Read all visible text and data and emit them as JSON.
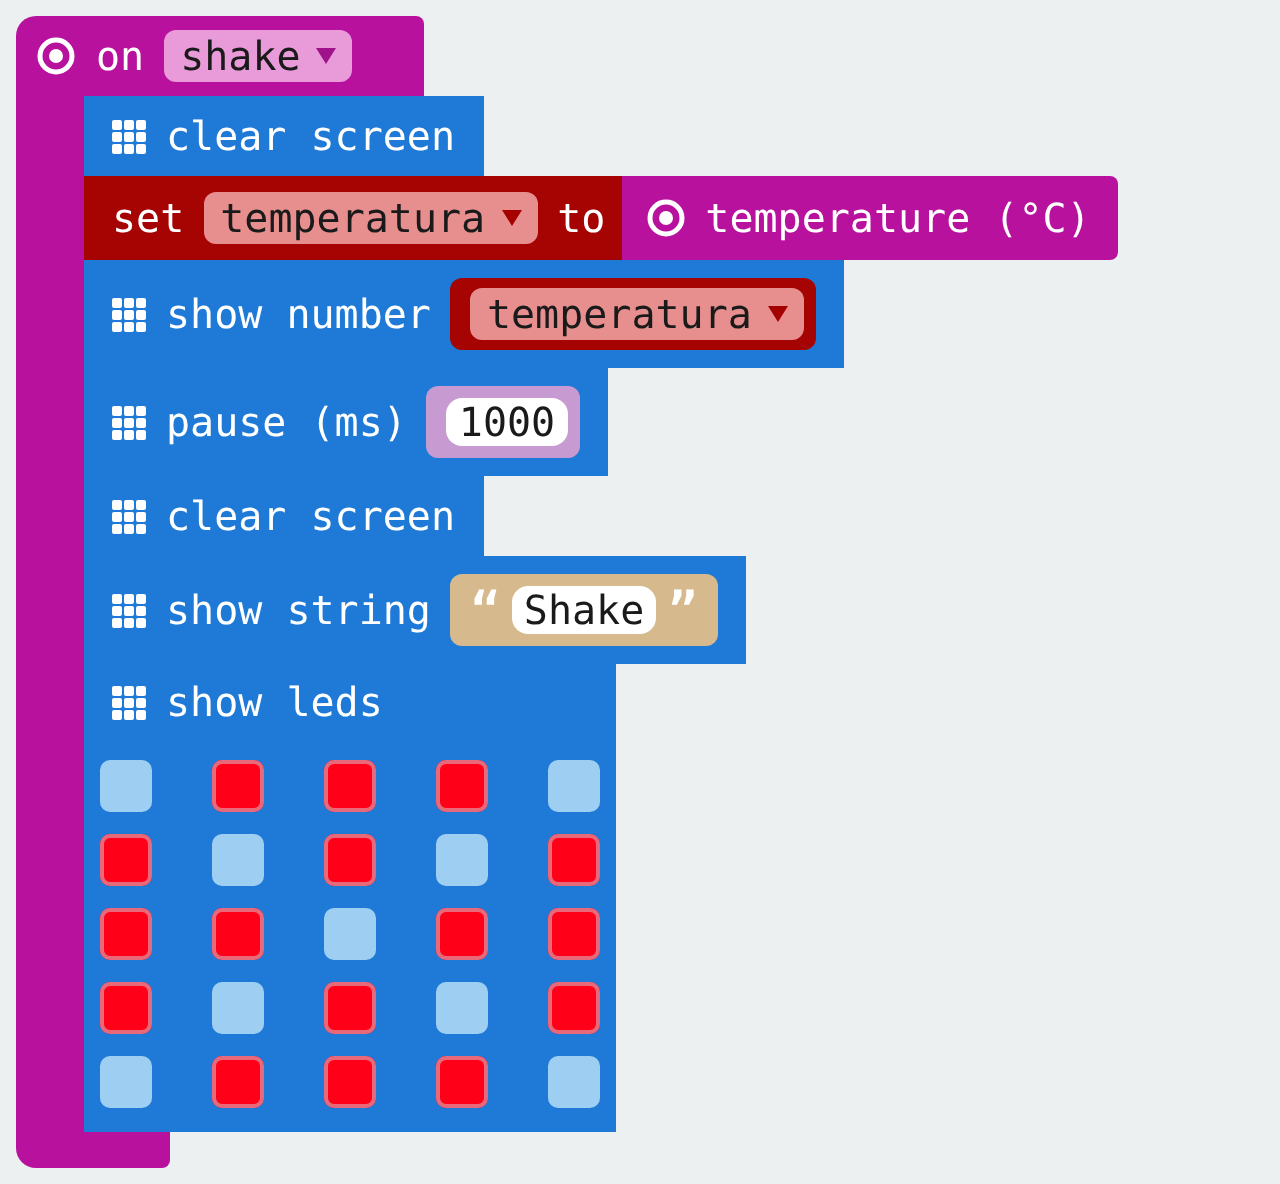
{
  "event": {
    "keyword": "on",
    "option": "shake"
  },
  "blocks": [
    {
      "kind": "plain",
      "label": "clear screen"
    },
    {
      "kind": "set",
      "label": "set",
      "variable": "temperatura",
      "connector": "to",
      "value": "temperature (°C)"
    },
    {
      "kind": "variable",
      "label": "show number",
      "variable": "temperatura"
    },
    {
      "kind": "number",
      "label": "pause (ms)",
      "value": "1000"
    },
    {
      "kind": "plain",
      "label": "clear screen"
    },
    {
      "kind": "string",
      "label": "show string",
      "open_quote": "“",
      "value": "Shake",
      "close_quote": "”"
    },
    {
      "kind": "leds",
      "label": "show leds",
      "leds": [
        [
          false,
          true,
          true,
          true,
          false
        ],
        [
          true,
          false,
          true,
          false,
          true
        ],
        [
          true,
          true,
          false,
          true,
          true
        ],
        [
          true,
          false,
          true,
          false,
          true
        ],
        [
          false,
          true,
          true,
          true,
          false
        ]
      ]
    }
  ]
}
